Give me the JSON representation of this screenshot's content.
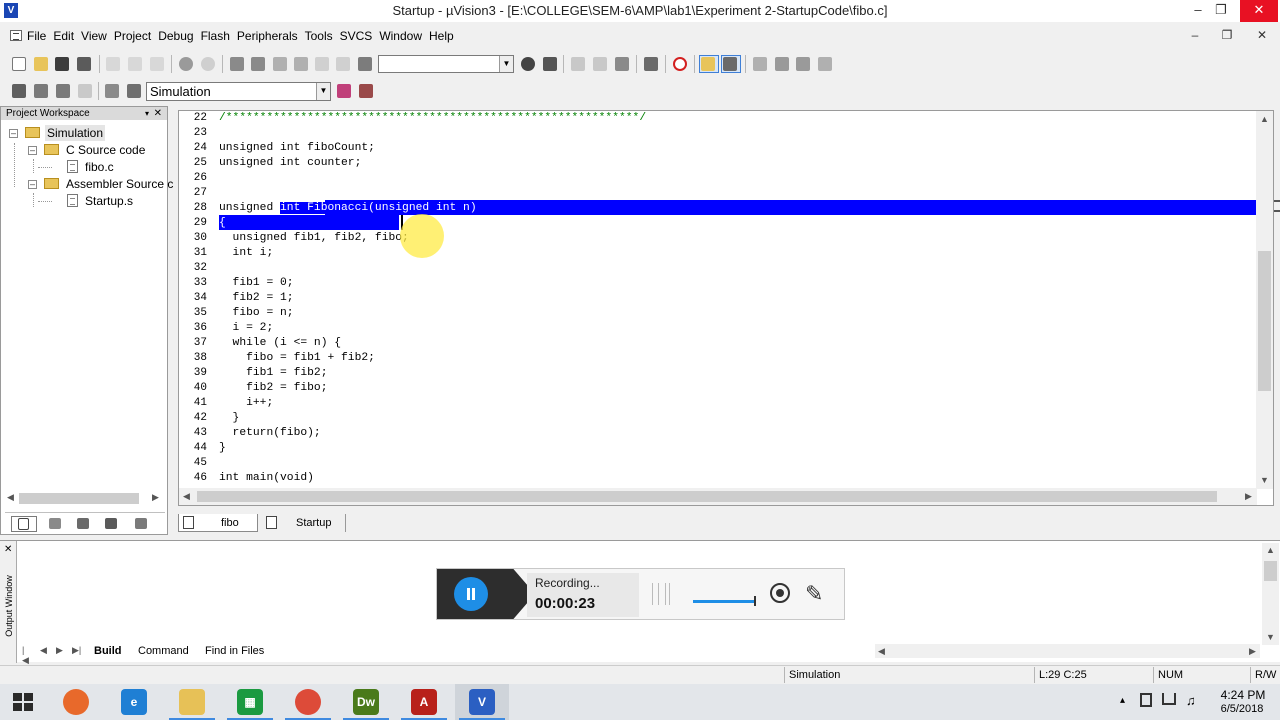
{
  "window": {
    "title": "Startup - µVision3 - [E:\\COLLEGE\\SEM-6\\AMP\\lab1\\Experiment 2-StartupCode\\fibo.c]",
    "app_icon_letter": "V",
    "controls": {
      "minimize": "–",
      "maximize": "❐",
      "close": "✕"
    }
  },
  "menu": {
    "items": [
      "File",
      "Edit",
      "View",
      "Project",
      "Debug",
      "Flash",
      "Peripherals",
      "Tools",
      "SVCS",
      "Window",
      "Help"
    ],
    "mdi_controls": {
      "minimize": "–",
      "restore": "❐",
      "close": "✕"
    }
  },
  "toolbar": {
    "find_value": "",
    "target_value": "Simulation"
  },
  "workspace": {
    "title": "Project Workspace",
    "close": "✕",
    "pin": "▾",
    "tree": [
      {
        "label": "Simulation",
        "level": 0,
        "kind": "target",
        "selected": true
      },
      {
        "label": "C Source code",
        "level": 1,
        "kind": "folder"
      },
      {
        "label": "fibo.c",
        "level": 2,
        "kind": "file"
      },
      {
        "label": "Assembler Source c",
        "level": 1,
        "kind": "folder"
      },
      {
        "label": "Startup.s",
        "level": 2,
        "kind": "file"
      }
    ]
  },
  "editor": {
    "lines": [
      {
        "n": "22",
        "text": "/*************************************************************/"
      },
      {
        "n": "23",
        "text": ""
      },
      {
        "n": "24",
        "text": "unsigned int fiboCount;"
      },
      {
        "n": "25",
        "text": "unsigned int counter;"
      },
      {
        "n": "26",
        "text": ""
      },
      {
        "n": "27",
        "text": ""
      },
      {
        "n": "28",
        "text": "unsigned int Fibonacci(unsigned int n)"
      },
      {
        "n": "29",
        "text": "{"
      },
      {
        "n": "30",
        "text": "  unsigned fib1, fib2, fibo;"
      },
      {
        "n": "31",
        "text": "  int i;"
      },
      {
        "n": "32",
        "text": ""
      },
      {
        "n": "33",
        "text": "  fib1 = 0;"
      },
      {
        "n": "34",
        "text": "  fib2 = 1;"
      },
      {
        "n": "35",
        "text": "  fibo = n;"
      },
      {
        "n": "36",
        "text": "  i = 2;"
      },
      {
        "n": "37",
        "text": "  while (i <= n) {"
      },
      {
        "n": "38",
        "text": "    fibo = fib1 + fib2;"
      },
      {
        "n": "39",
        "text": "    fib1 = fib2;"
      },
      {
        "n": "40",
        "text": "    fib2 = fibo;"
      },
      {
        "n": "41",
        "text": "    i++;"
      },
      {
        "n": "42",
        "text": "  }"
      },
      {
        "n": "43",
        "text": "  return(fibo);"
      },
      {
        "n": "44",
        "text": "}"
      },
      {
        "n": "45",
        "text": ""
      },
      {
        "n": "46",
        "text": "int main(void)"
      }
    ],
    "line28_prefix": "unsigned ",
    "line28_selected": "int Fibonacci(unsigned int n)",
    "tabs": [
      "fibo",
      "Startup"
    ]
  },
  "output": {
    "side_label": "Output Window",
    "close": "✕",
    "tabs": [
      "Build",
      "Command",
      "Find in Files"
    ],
    "active_tab": "Build"
  },
  "recorder": {
    "status": "Recording...",
    "time": "00:00:23",
    "pen_icon": "✎"
  },
  "statusbar": {
    "mode": "Simulation",
    "position": "L:29 C:25",
    "num": "NUM",
    "rw": "R/W"
  },
  "taskbar": {
    "apps": [
      {
        "name": "firefox",
        "color": "#e8692b",
        "glyph": ""
      },
      {
        "name": "internet-explorer",
        "color": "#1f7fd4",
        "glyph": "e"
      },
      {
        "name": "file-explorer",
        "color": "#e7c157",
        "glyph": ""
      },
      {
        "name": "store",
        "color": "#1b9a41",
        "glyph": "▦"
      },
      {
        "name": "chrome",
        "color": "#dd4b39",
        "glyph": ""
      },
      {
        "name": "dreamweaver",
        "color": "#4a7a1a",
        "glyph": "Dw"
      },
      {
        "name": "acrobat",
        "color": "#b8211a",
        "glyph": "A"
      },
      {
        "name": "uvision",
        "color": "#2b5fc2",
        "glyph": "V"
      }
    ],
    "time": "4:24 PM",
    "date": "6/5/2018",
    "tray_up": "▴",
    "tray_volume": "♫"
  },
  "colors": {
    "selection": "#0000ff",
    "comment": "#008000",
    "accent": "#1e8ee6"
  }
}
